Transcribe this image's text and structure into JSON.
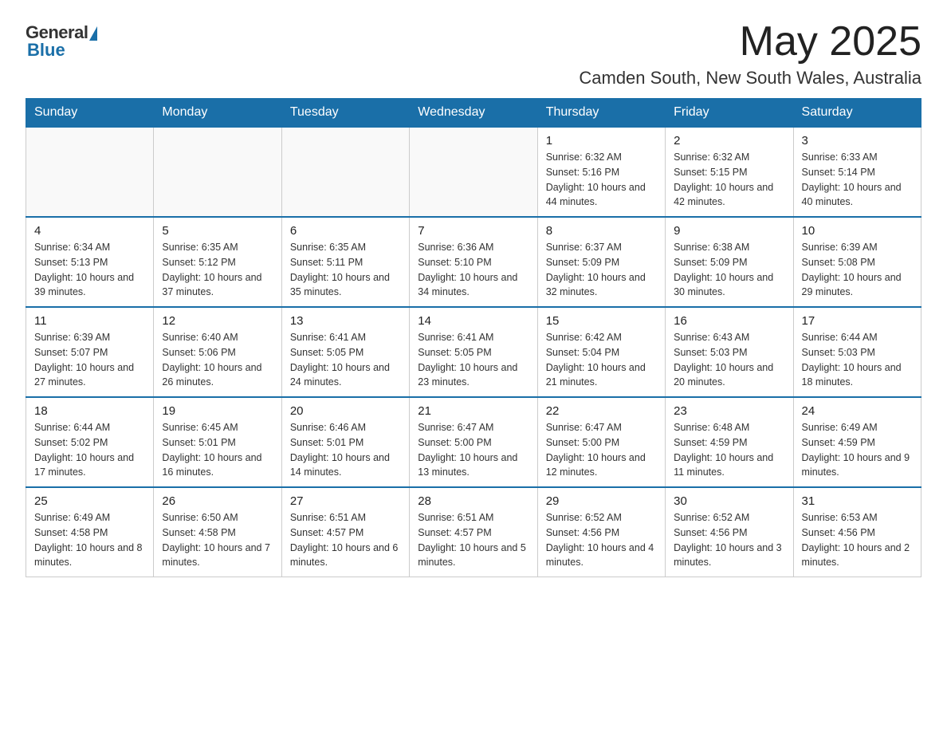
{
  "logo": {
    "general": "General",
    "blue": "Blue"
  },
  "title": "May 2025",
  "location": "Camden South, New South Wales, Australia",
  "days_of_week": [
    "Sunday",
    "Monday",
    "Tuesday",
    "Wednesday",
    "Thursday",
    "Friday",
    "Saturday"
  ],
  "weeks": [
    [
      {
        "day": "",
        "info": ""
      },
      {
        "day": "",
        "info": ""
      },
      {
        "day": "",
        "info": ""
      },
      {
        "day": "",
        "info": ""
      },
      {
        "day": "1",
        "info": "Sunrise: 6:32 AM\nSunset: 5:16 PM\nDaylight: 10 hours and 44 minutes."
      },
      {
        "day": "2",
        "info": "Sunrise: 6:32 AM\nSunset: 5:15 PM\nDaylight: 10 hours and 42 minutes."
      },
      {
        "day": "3",
        "info": "Sunrise: 6:33 AM\nSunset: 5:14 PM\nDaylight: 10 hours and 40 minutes."
      }
    ],
    [
      {
        "day": "4",
        "info": "Sunrise: 6:34 AM\nSunset: 5:13 PM\nDaylight: 10 hours and 39 minutes."
      },
      {
        "day": "5",
        "info": "Sunrise: 6:35 AM\nSunset: 5:12 PM\nDaylight: 10 hours and 37 minutes."
      },
      {
        "day": "6",
        "info": "Sunrise: 6:35 AM\nSunset: 5:11 PM\nDaylight: 10 hours and 35 minutes."
      },
      {
        "day": "7",
        "info": "Sunrise: 6:36 AM\nSunset: 5:10 PM\nDaylight: 10 hours and 34 minutes."
      },
      {
        "day": "8",
        "info": "Sunrise: 6:37 AM\nSunset: 5:09 PM\nDaylight: 10 hours and 32 minutes."
      },
      {
        "day": "9",
        "info": "Sunrise: 6:38 AM\nSunset: 5:09 PM\nDaylight: 10 hours and 30 minutes."
      },
      {
        "day": "10",
        "info": "Sunrise: 6:39 AM\nSunset: 5:08 PM\nDaylight: 10 hours and 29 minutes."
      }
    ],
    [
      {
        "day": "11",
        "info": "Sunrise: 6:39 AM\nSunset: 5:07 PM\nDaylight: 10 hours and 27 minutes."
      },
      {
        "day": "12",
        "info": "Sunrise: 6:40 AM\nSunset: 5:06 PM\nDaylight: 10 hours and 26 minutes."
      },
      {
        "day": "13",
        "info": "Sunrise: 6:41 AM\nSunset: 5:05 PM\nDaylight: 10 hours and 24 minutes."
      },
      {
        "day": "14",
        "info": "Sunrise: 6:41 AM\nSunset: 5:05 PM\nDaylight: 10 hours and 23 minutes."
      },
      {
        "day": "15",
        "info": "Sunrise: 6:42 AM\nSunset: 5:04 PM\nDaylight: 10 hours and 21 minutes."
      },
      {
        "day": "16",
        "info": "Sunrise: 6:43 AM\nSunset: 5:03 PM\nDaylight: 10 hours and 20 minutes."
      },
      {
        "day": "17",
        "info": "Sunrise: 6:44 AM\nSunset: 5:03 PM\nDaylight: 10 hours and 18 minutes."
      }
    ],
    [
      {
        "day": "18",
        "info": "Sunrise: 6:44 AM\nSunset: 5:02 PM\nDaylight: 10 hours and 17 minutes."
      },
      {
        "day": "19",
        "info": "Sunrise: 6:45 AM\nSunset: 5:01 PM\nDaylight: 10 hours and 16 minutes."
      },
      {
        "day": "20",
        "info": "Sunrise: 6:46 AM\nSunset: 5:01 PM\nDaylight: 10 hours and 14 minutes."
      },
      {
        "day": "21",
        "info": "Sunrise: 6:47 AM\nSunset: 5:00 PM\nDaylight: 10 hours and 13 minutes."
      },
      {
        "day": "22",
        "info": "Sunrise: 6:47 AM\nSunset: 5:00 PM\nDaylight: 10 hours and 12 minutes."
      },
      {
        "day": "23",
        "info": "Sunrise: 6:48 AM\nSunset: 4:59 PM\nDaylight: 10 hours and 11 minutes."
      },
      {
        "day": "24",
        "info": "Sunrise: 6:49 AM\nSunset: 4:59 PM\nDaylight: 10 hours and 9 minutes."
      }
    ],
    [
      {
        "day": "25",
        "info": "Sunrise: 6:49 AM\nSunset: 4:58 PM\nDaylight: 10 hours and 8 minutes."
      },
      {
        "day": "26",
        "info": "Sunrise: 6:50 AM\nSunset: 4:58 PM\nDaylight: 10 hours and 7 minutes."
      },
      {
        "day": "27",
        "info": "Sunrise: 6:51 AM\nSunset: 4:57 PM\nDaylight: 10 hours and 6 minutes."
      },
      {
        "day": "28",
        "info": "Sunrise: 6:51 AM\nSunset: 4:57 PM\nDaylight: 10 hours and 5 minutes."
      },
      {
        "day": "29",
        "info": "Sunrise: 6:52 AM\nSunset: 4:56 PM\nDaylight: 10 hours and 4 minutes."
      },
      {
        "day": "30",
        "info": "Sunrise: 6:52 AM\nSunset: 4:56 PM\nDaylight: 10 hours and 3 minutes."
      },
      {
        "day": "31",
        "info": "Sunrise: 6:53 AM\nSunset: 4:56 PM\nDaylight: 10 hours and 2 minutes."
      }
    ]
  ]
}
